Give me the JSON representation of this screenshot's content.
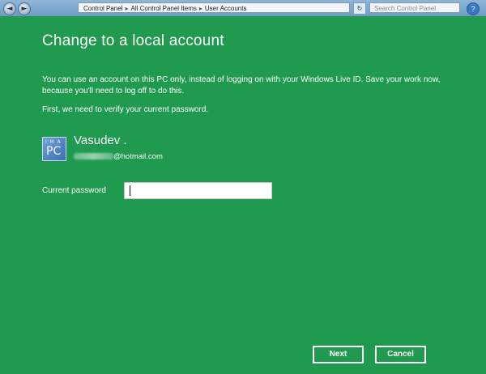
{
  "explorer": {
    "breadcrumb": [
      "Control Panel",
      "All Control Panel Items",
      "User Accounts"
    ],
    "search_placeholder": "Search Control Panel",
    "back_glyph": "◄",
    "forward_glyph": "►",
    "help_glyph": "?"
  },
  "dialog": {
    "title": "Change to a local account",
    "intro": "You can use an account on this PC only, instead of logging on with your Windows Live ID. Save your work now, because you'll need to log off to do this.",
    "verify_text": "First, we need to verify your current password.",
    "user": {
      "name": "Vasudev .",
      "email_domain": "@hotmail.com",
      "avatar_top_text": "I'M A",
      "avatar_text": "PC"
    },
    "password": {
      "label": "Current password",
      "value": "",
      "placeholder": ""
    },
    "buttons": {
      "next": "Next",
      "cancel": "Cancel"
    }
  },
  "colors": {
    "background": "#1f9a4f",
    "text": "#ffffff"
  }
}
